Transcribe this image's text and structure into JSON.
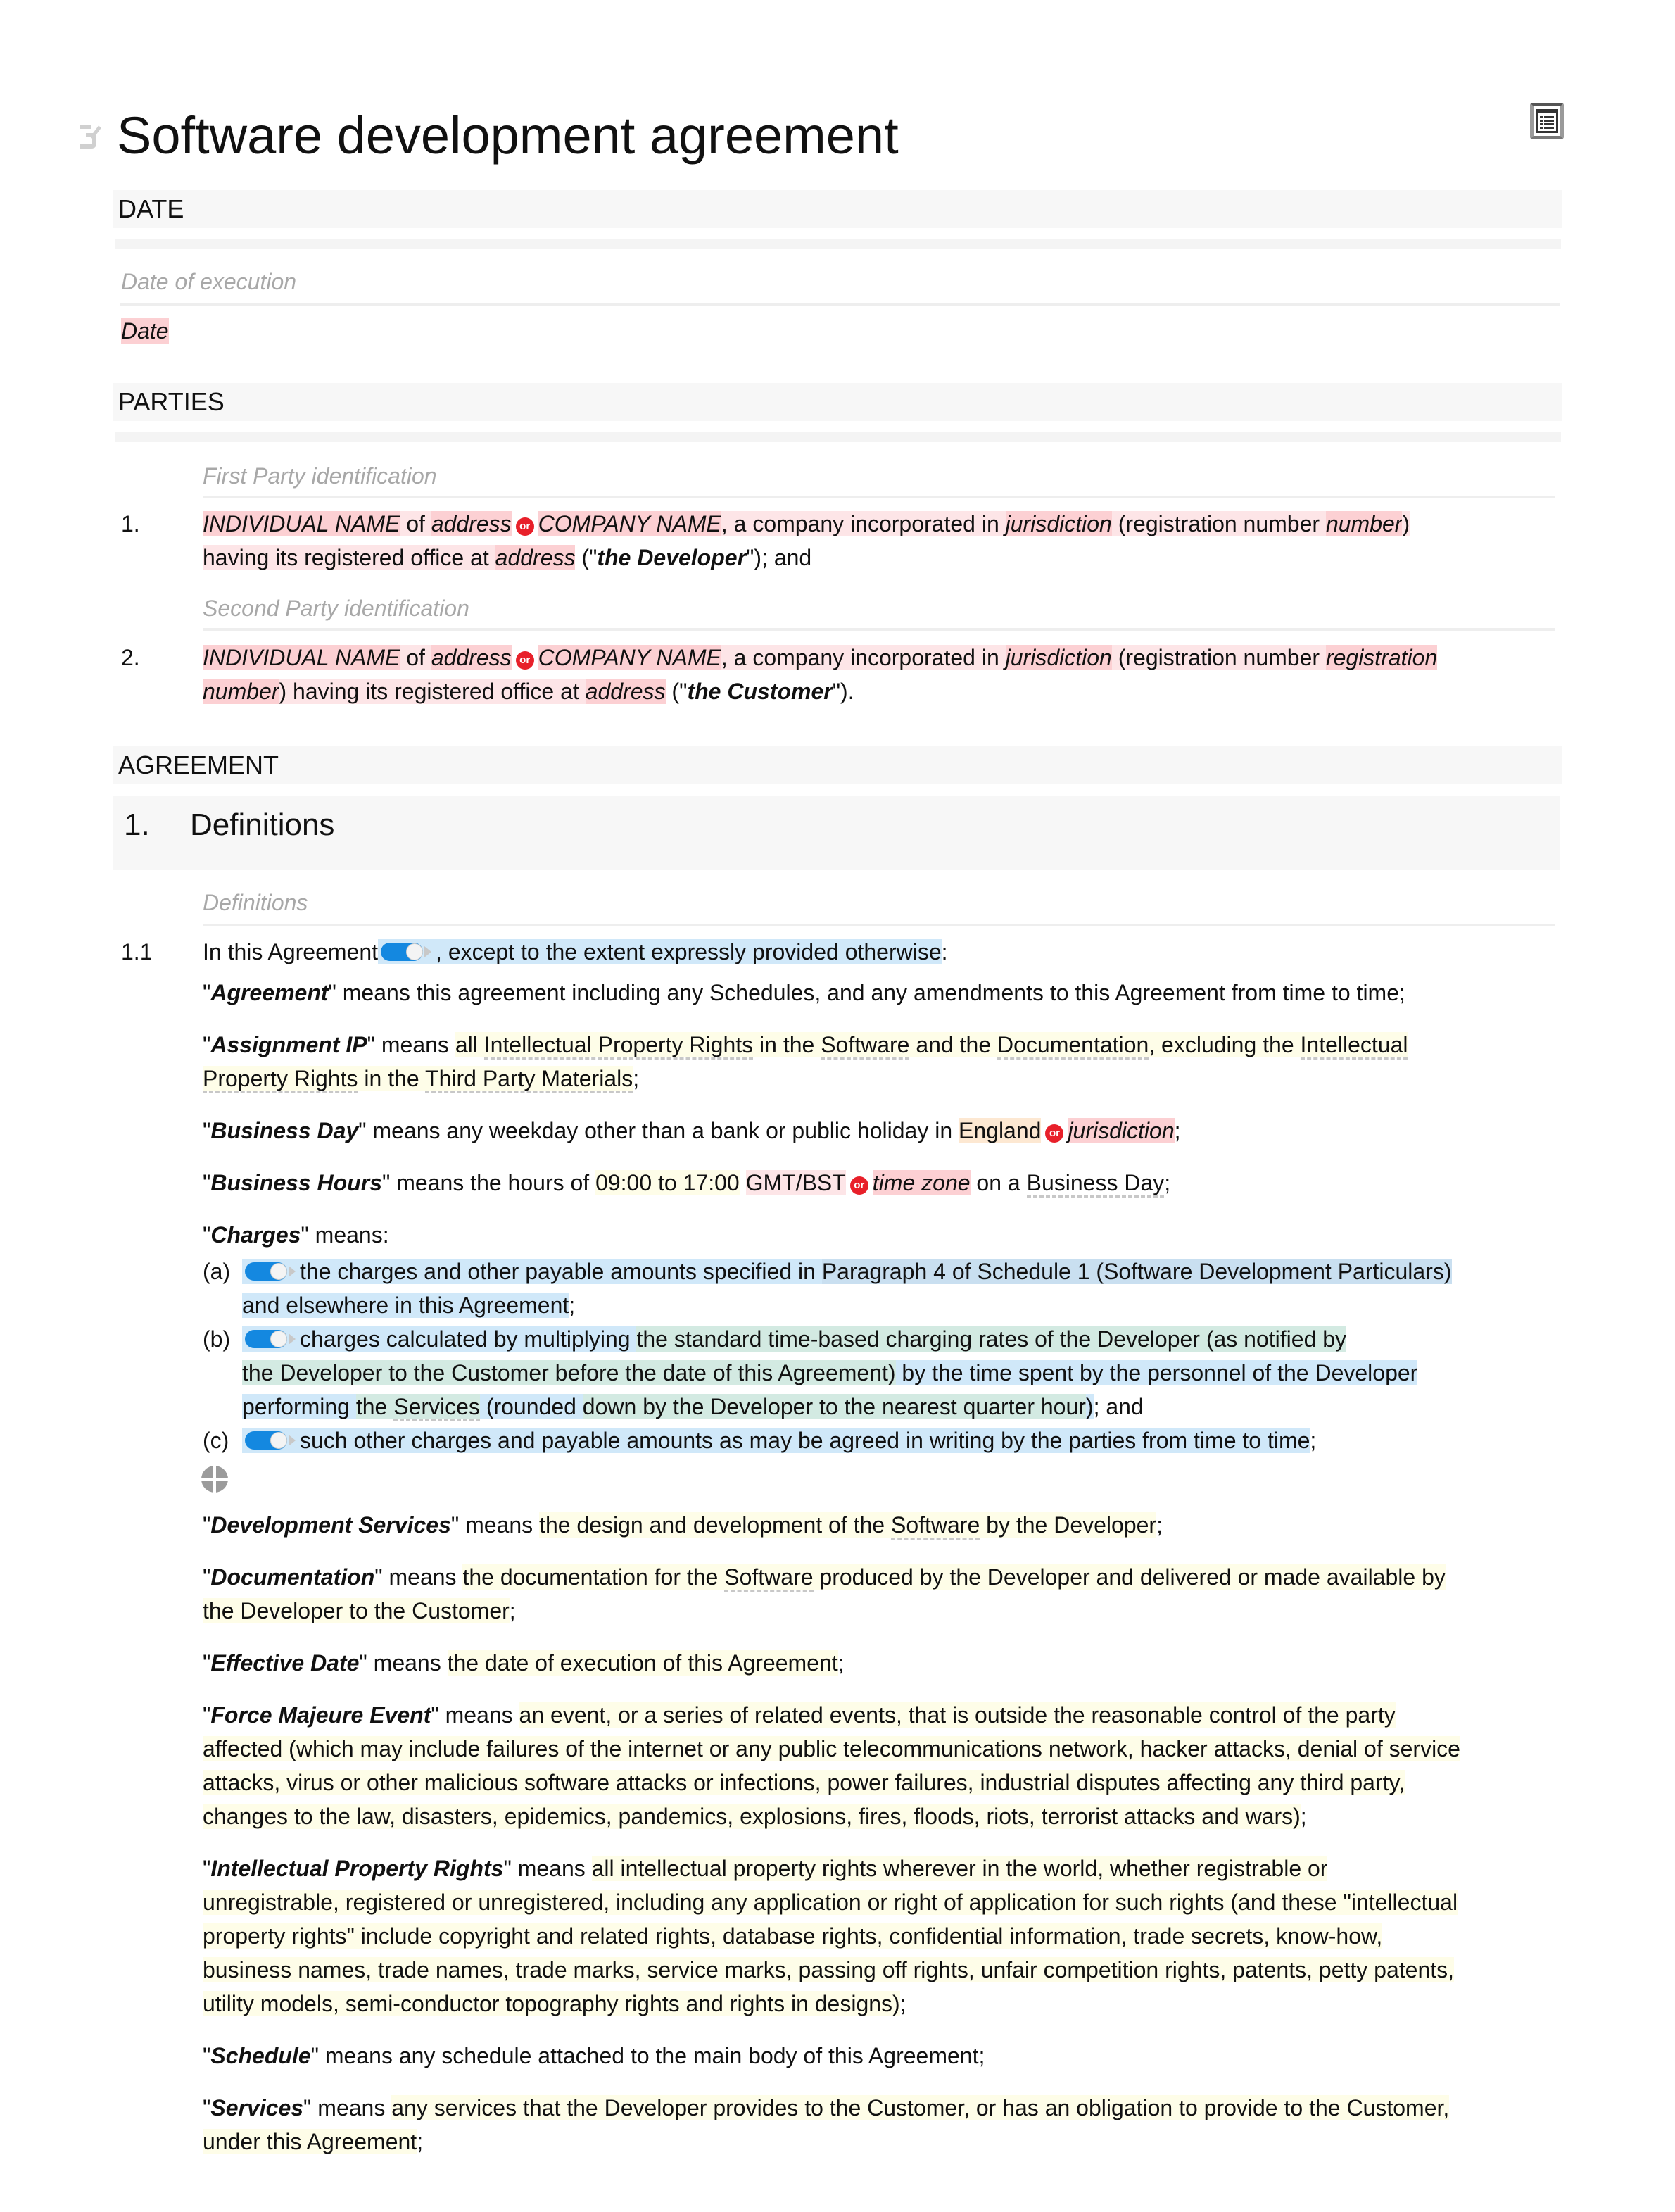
{
  "header": {
    "title": "Software development agreement",
    "edit_icon": "edit-icon",
    "toc_icon": "table-of-contents-icon"
  },
  "date_section": {
    "heading": "DATE",
    "field_label": "Date of execution",
    "value": "Date"
  },
  "parties_section": {
    "heading": "PARTIES",
    "first": {
      "field_label": "First Party identification",
      "number": "1.",
      "individual_name": "INDIVIDUAL NAME",
      "of": " of ",
      "address": "address",
      "or_label": "or",
      "company_name": "COMPANY NAME",
      "text1": ", a company incorporated in ",
      "jurisdiction": "jurisdiction",
      "text2": " (registration number ",
      "reg_number": "number",
      "text3": ")",
      "text4": "having its registered office at ",
      "office_address": "address",
      "text5": " (\"",
      "defined": "the Developer",
      "text6": "\"); and"
    },
    "second": {
      "field_label": "Second Party identification",
      "number": "2.",
      "individual_name": "INDIVIDUAL NAME",
      "of": " of ",
      "address": "address",
      "or_label": "or",
      "company_name": "COMPANY NAME",
      "text1": ", a company incorporated in ",
      "jurisdiction": "jurisdiction",
      "text2": " (registration number ",
      "reg_number_a": "registration",
      "reg_number_b": "number",
      "text3": ") having its registered office at ",
      "office_address": "address",
      "text5": " (\"",
      "defined": "the Customer",
      "text6": "\")."
    }
  },
  "agreement_section": {
    "heading": "AGREEMENT",
    "clause_number": "1.",
    "clause_title": "Definitions",
    "field_label": "Definitions",
    "sub_number": "1.1",
    "intro_a": "In this Agreement",
    "intro_b": ", except to the extent expressly provided otherwise",
    "intro_c": ":",
    "definitions": {
      "agreement": {
        "term": "Agreement",
        "text": "\" means this agreement including any Schedules, and any amendments to this Agreement from time to time;"
      },
      "assignment_ip": {
        "term": "Assignment IP",
        "means": "\" means ",
        "l1_a": "all ",
        "l1_b": "Intellectual Property Rights",
        "l1_c": " in the ",
        "l1_d": "Software",
        "l1_e": " and the ",
        "l1_f": "Documentation",
        "l1_g": ", excluding the ",
        "l1_h": "Intellectual",
        "l2_a": "Property Rights",
        "l2_b": " in the ",
        "l2_c": "Third Party Materials",
        "l2_d": ";"
      },
      "business_day": {
        "term": "Business Day",
        "text": "\" means any weekday other than a bank or public holiday in ",
        "option1": "England",
        "or_label": "or",
        "option2": "jurisdiction",
        "end": ";"
      },
      "business_hours": {
        "term": "Business Hours",
        "text": "\" means the hours of ",
        "hours": "09:00 to 17:00",
        "tz": "GMT/BST",
        "or_label": "or",
        "tz_alt": "time zone",
        "text2": " on a ",
        "link": "Business Day",
        "end": ";"
      },
      "charges": {
        "term": "Charges",
        "text": "\" means:",
        "items": [
          {
            "label": "(a)",
            "l1_a": "the charges and other payable amounts specified in ",
            "l1_b": "Paragraph 4 of Schedule 1 (Software Development Particulars)",
            "l2": "and elsewhere in this Agreement",
            "end": ";"
          },
          {
            "label": "(b)",
            "l1_a": "charges calculated by multiplying ",
            "l1_b": "the standard time-based charging rates of the Developer (as notified by",
            "l2_a": "the Developer to the Customer before the date of this Agreement)",
            "l2_b": " by the time spent by the personnel of the Developer",
            "l3_a": "performing ",
            "l3_b": "the ",
            "l3_c": "Services",
            "l3_d": " (rounded ",
            "l3_e": "down by the Developer to the nearest quarter hour",
            "l3_f": ")",
            "end": "; and"
          },
          {
            "label": "(c)",
            "l1_a": "such other charges and payable amounts as may be agreed in writing by the parties from time to time",
            "end": ";"
          }
        ]
      },
      "development_services": {
        "term": "Development Services",
        "means": "\" means ",
        "a": "the design and development of the ",
        "b": "Software",
        "c": " by the Developer",
        "end": ";"
      },
      "documentation": {
        "term": "Documentation",
        "means": "\" means ",
        "l1_a": "the documentation for the ",
        "l1_b": "Software",
        "l1_c": " produced by the Developer and delivered or made available by",
        "l2": "the Developer to the Customer",
        "end": ";"
      },
      "effective_date": {
        "term": "Effective Date",
        "means": "\" means ",
        "a": "the date of execution of this Agreement",
        "end": ";"
      },
      "force_majeure": {
        "term": "Force Majeure Event",
        "means": "\" means ",
        "lines": [
          "an event, or a series of related events, that is outside the reasonable control of the party",
          "affected (which may include failures of the internet or any public telecommunications network, hacker attacks, denial of service",
          "attacks, virus or other malicious software attacks or infections, power failures, industrial disputes affecting any third party,",
          "changes to the law, disasters, epidemics, pandemics, explosions, fires, floods, riots, terrorist attacks and wars)"
        ],
        "end": ";"
      },
      "ipr": {
        "term": "Intellectual Property Rights",
        "means": "\" means ",
        "lines": [
          "all intellectual property rights wherever in the world, whether registrable or",
          "unregistrable, registered or unregistered, including any application or right of application for such rights (and these \"intellectual",
          "property rights\" include copyright and related rights, database rights, confidential information, trade secrets, know-how,",
          "business names, trade names, trade marks, service marks, passing off rights, unfair competition rights, patents, petty patents,",
          "utility models, semi-conductor topography rights and rights in designs)"
        ],
        "end": ";"
      },
      "schedule": {
        "term": "Schedule",
        "text": "\" means any schedule attached to the main body of this Agreement;"
      },
      "services": {
        "term": "Services",
        "means": "\" means ",
        "l1": "any services that the Developer provides to the Customer, or has an obligation to provide to the Customer,",
        "l2": "under this Agreement",
        "end": ";"
      }
    },
    "add_icon": "add-clause-icon"
  },
  "colors": {
    "placeholder": "#fcd0d3",
    "placeholder_light": "#fde5e7",
    "or_badge": "#e8202a",
    "optional_text": "#d0e8f9",
    "toggle_on": "#1488e0",
    "editable_text": "#fefde8",
    "selected_option": "#fde8d2",
    "nested_optional": "#d3eae2"
  }
}
